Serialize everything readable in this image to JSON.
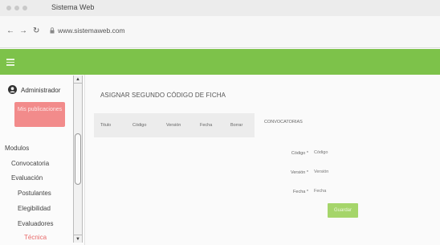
{
  "browser": {
    "window_title": "Sistema Web",
    "url": "www.sistemaweb.com",
    "icons": [
      "back-arrow-icon",
      "forward-arrow-icon",
      "reload-icon",
      "lock-icon"
    ]
  },
  "app": {
    "accent_color": "#7dc24a",
    "menu_icon": "hamburger-icon"
  },
  "sidebar": {
    "user_name": "Administrador",
    "publications_button": "Mis publicaciones",
    "items": [
      {
        "label": "Modulos",
        "active": false
      },
      {
        "label": "Convocatoria",
        "active": false
      },
      {
        "label": "Evaluación",
        "active": false
      },
      {
        "label": "Postulantes",
        "active": false
      },
      {
        "label": "Elegibilidad",
        "active": false
      },
      {
        "label": "Evaluadores",
        "active": false
      },
      {
        "label": "Técnica",
        "active": true
      }
    ]
  },
  "main": {
    "title": "ASIGNAR SEGUNDO CÓDIGO DE FICHA",
    "table": {
      "columns": [
        "Titulo",
        "Código",
        "Versión",
        "Fecha",
        "Borrar"
      ]
    },
    "form": {
      "title": "CONVOCATORIAS",
      "fields": [
        {
          "label": "Código *",
          "placeholder": "Código"
        },
        {
          "label": "Versión *",
          "placeholder": "Versión"
        },
        {
          "label": "Fecha *",
          "placeholder": "Fecha"
        }
      ],
      "submit_label": "Guardar"
    }
  }
}
